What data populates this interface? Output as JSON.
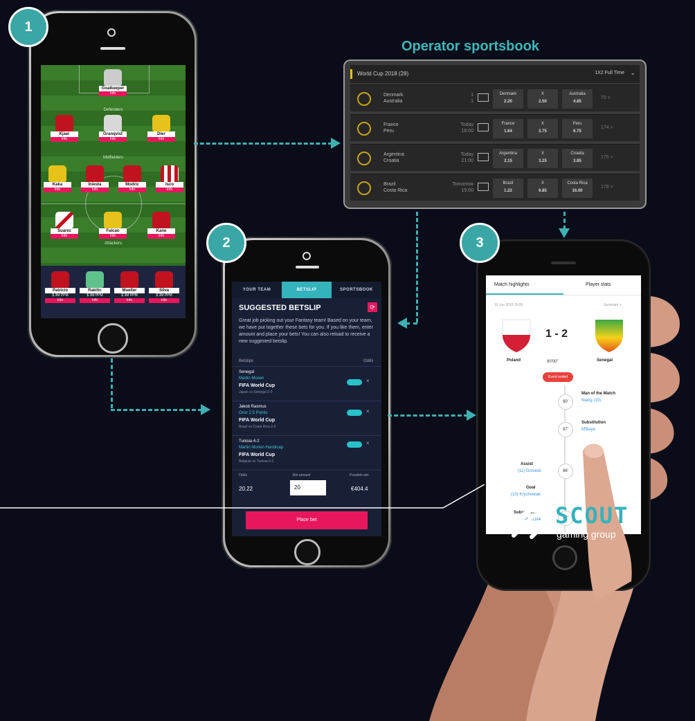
{
  "badges": [
    "1",
    "2",
    "3"
  ],
  "operator_label": "Operator sportsbook",
  "fantasy": {
    "positions": [
      "Goalkeeper",
      "Defenders",
      "Midfielders",
      "Attackers"
    ],
    "players_row1": [
      "Kjaer",
      "Granqvist",
      "Dier"
    ],
    "players_row2": [
      "Kaka",
      "Iniesta",
      "Modric",
      "Isco"
    ],
    "players_row3": [
      "Suarez",
      "Kane",
      "Falcao"
    ],
    "bench": [
      "Patricio",
      "Rakitic",
      "Mueller",
      "Silva"
    ],
    "bench_values": [
      "$ 3M PPM",
      "$ 3M PPM",
      "$ 3M PPM",
      "$ 3M PPM"
    ],
    "info": "Info"
  },
  "sportsbook": {
    "header": "World Cup 2018 (28)",
    "market": "1X2 Full Time",
    "rows": [
      {
        "home": "Denmark",
        "away": "Australia",
        "time": "1\n1",
        "o1_name": "Denmark",
        "o1": "2.20",
        "ox": "2.50",
        "o2_name": "Australia",
        "o2": "4.85",
        "more": "75 >"
      },
      {
        "home": "France",
        "away": "Peru",
        "time": "Today\n18:00",
        "o1_name": "France",
        "o1": "1.64",
        "ox": "3.75",
        "o2_name": "Peru",
        "o2": "6.75",
        "more": "174 >"
      },
      {
        "home": "Argentina",
        "away": "Croatia",
        "time": "Today\n21:00",
        "o1_name": "Argentina",
        "o1": "2.15",
        "ox": "3.25",
        "o2_name": "Croatia",
        "o2": "3.85",
        "more": "175 >"
      },
      {
        "home": "Brazil",
        "away": "Costa Rica",
        "time": "Tomorrow\n15:00",
        "o1_name": "Brazil",
        "o1": "1.22",
        "ox": "6.85",
        "o2_name": "Costa Rica",
        "o2": "16.00",
        "more": "178 >"
      }
    ],
    "x_label": "X"
  },
  "betslip": {
    "tabs": [
      "YOUR TEAM",
      "BETSLIP",
      "SPORTSBOOK"
    ],
    "title": "SUGGESTED BETSLIP",
    "intro": "Great job picking out your Fantasy team! Based on your team, we have put together these bets for you. If you like them, enter amount and place your bets! You can also reload to receive a new suggested betslip.",
    "col_betslips": "Betslips",
    "col_odds": "Odds",
    "bets": [
      {
        "team": "Senegal",
        "player": "Martin Musen",
        "comp": "FIFA World Cup",
        "match": "Japan vs Senegal 2-0"
      },
      {
        "team": "Jakob Rasmus",
        "player": "Over 2.5 Points",
        "comp": "FIFA World Cup",
        "match": "Brazil vs Costa Rica 2-0"
      },
      {
        "team": "Tunisia 4-2",
        "player": "Martin Morten Handicap",
        "comp": "FIFA World Cup",
        "match": "Belgium vs Tunisia 5-2"
      }
    ],
    "odds_label": "Odds",
    "bet_amount_label": "Bet amount",
    "win_label": "Possible win",
    "odds_value": "20.22",
    "amount_value": "20",
    "win_value": "€404.4",
    "place_bet": "Place bet"
  },
  "stats": {
    "tab_highlights": "Match highlights",
    "tab_player": "Player stats",
    "date": "19 Jun 2018 16:00",
    "summary": "Summary >",
    "score": "1 - 2",
    "home": "Poland",
    "away": "Senegal",
    "clock": "90'00\"",
    "event_btn": "Event ended",
    "events": [
      {
        "min": "90'",
        "title": "Man of the Match",
        "name": "Niang (19)"
      },
      {
        "min": "87'",
        "title": "Substitution",
        "name": "M'Baye"
      },
      {
        "min": "86'",
        "title": "Assist",
        "name": "(11) Grosicki"
      },
      {
        "min": "86'",
        "title": "Goal",
        "name": "(10) Krychowiak"
      },
      {
        "min": "87'",
        "title": "Substitution",
        "name": "Piszczek"
      }
    ]
  },
  "logo": {
    "name": "SCOUT",
    "sub": "gaming group"
  },
  "colors": {
    "bg": "#0a0d19",
    "teal": "#3fb0b3",
    "pink": "#e8175d"
  }
}
